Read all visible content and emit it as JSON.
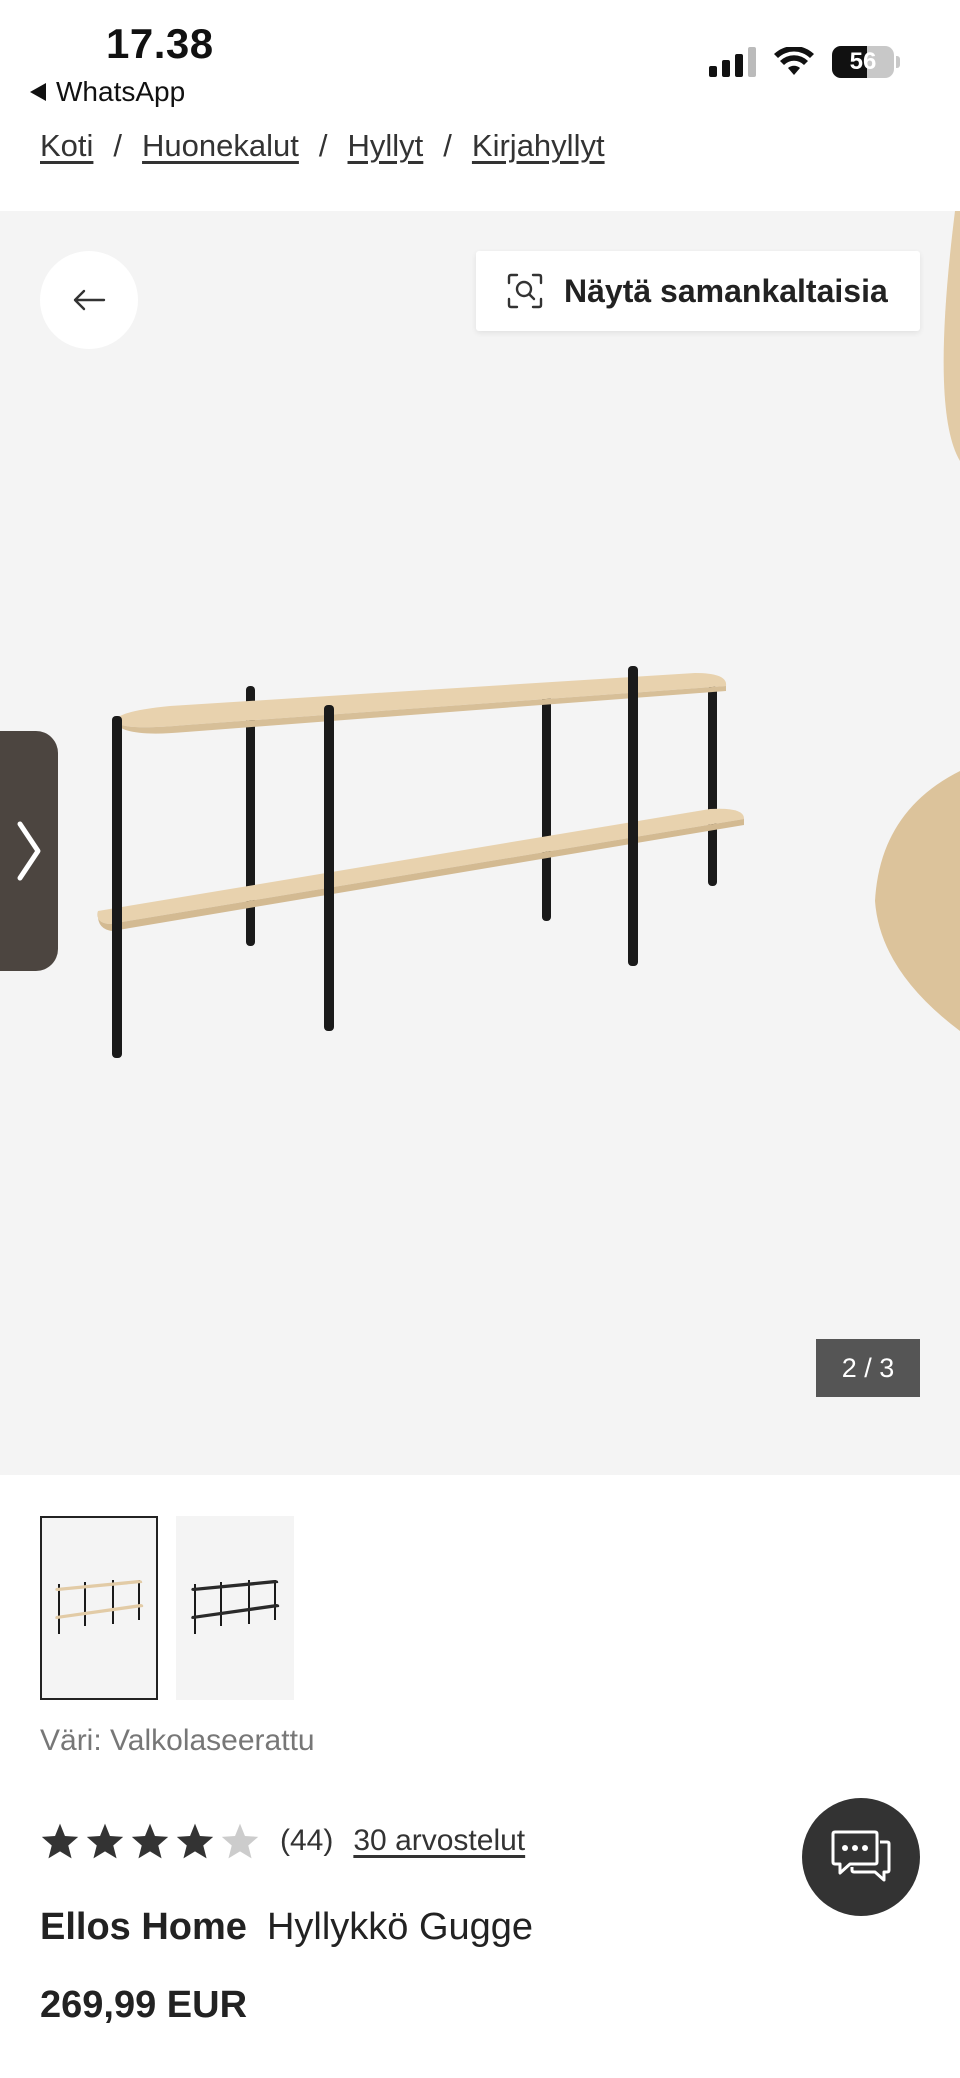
{
  "status_bar": {
    "time": "17.38",
    "back_app": "WhatsApp",
    "battery": "56",
    "battery_level": 0.56
  },
  "breadcrumb": [
    "Koti",
    "Huonekalut",
    "Hyllyt",
    "Kirjahyllyt"
  ],
  "breadcrumb_separator": "/",
  "gallery": {
    "similar_button": "Näytä samankaltaisia",
    "pager": "2 / 3"
  },
  "product": {
    "color_label": "Väri: Valkolaseerattu",
    "rating": 4,
    "rating_max": 5,
    "rating_count": "(44)",
    "reviews_link": "30 arvostelut",
    "brand": "Ellos Home",
    "name": "Hyllykkö Gugge",
    "price": "269,99 EUR"
  },
  "colors": {
    "wood": "#e8d2ae",
    "metal": "#1a1a1a",
    "chat_bg": "#333333",
    "side_tab": "#4c4540"
  }
}
